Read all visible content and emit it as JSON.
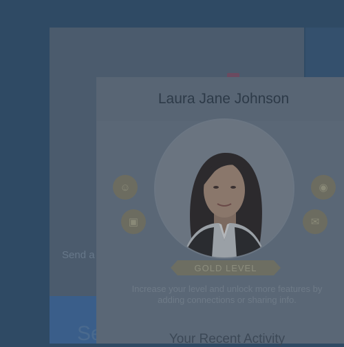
{
  "profile": {
    "name": "Laura Jane Johnson",
    "level_badge": "GOLD LEVEL",
    "description": "Increase your level and unlock more features by adding connections or sharing info.",
    "recent_heading": "Your Recent Activity"
  },
  "background": {
    "send_text": "Send a",
    "big_text": "Se"
  },
  "icons": {
    "social_left_top": "person-icon",
    "social_left_bottom": "card-icon",
    "social_right_top": "globe-icon",
    "social_right_bottom": "chat-icon"
  }
}
